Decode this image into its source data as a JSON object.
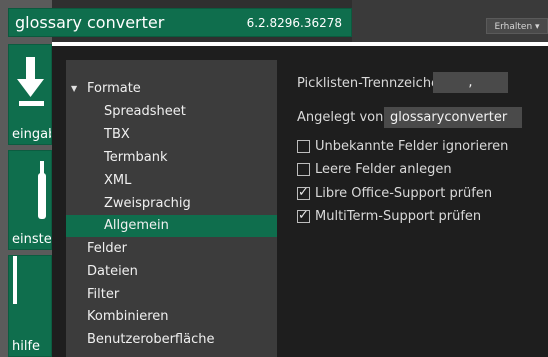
{
  "app": {
    "title": "glossary converter",
    "version": "6.2.8296.36278",
    "erhalten_label": "Erhalten ▾"
  },
  "tiles": [
    {
      "label": "eingabe",
      "icon": "download-arrow-icon"
    },
    {
      "label": "einstellungen",
      "icon": "wrench-icon"
    },
    {
      "label": "hilfe",
      "icon": "help-icon"
    }
  ],
  "tree": {
    "items": [
      {
        "label": "Formate",
        "level": 0,
        "expanded": true
      },
      {
        "label": "Spreadsheet",
        "level": 1
      },
      {
        "label": "TBX",
        "level": 1
      },
      {
        "label": "Termbank",
        "level": 1
      },
      {
        "label": "XML",
        "level": 1
      },
      {
        "label": "Zweisprachig",
        "level": 1
      },
      {
        "label": "Allgemein",
        "level": 1,
        "selected": true
      },
      {
        "label": "Felder",
        "level": 0
      },
      {
        "label": "Dateien",
        "level": 0
      },
      {
        "label": "Filter",
        "level": 0
      },
      {
        "label": "Kombinieren",
        "level": 0
      },
      {
        "label": "Benutzeroberfläche",
        "level": 0
      }
    ]
  },
  "settings": {
    "picklist_label": "Picklisten-Trennzeichen",
    "picklist_value": ",",
    "created_by_label": "Angelegt von",
    "created_by_value": "glossaryconverter",
    "checkboxes": [
      {
        "label": "Unbekannte Felder ignorieren",
        "checked": false
      },
      {
        "label": "Leere Felder anlegen",
        "checked": false
      },
      {
        "label": "Libre Office-Support prüfen",
        "checked": true
      },
      {
        "label": "MultiTerm-Support prüfen",
        "checked": true
      }
    ]
  },
  "colors": {
    "accent_green": "#0f6e4d",
    "panel_dark": "#1e1e1e",
    "tree_bg": "#3c3c3c"
  }
}
